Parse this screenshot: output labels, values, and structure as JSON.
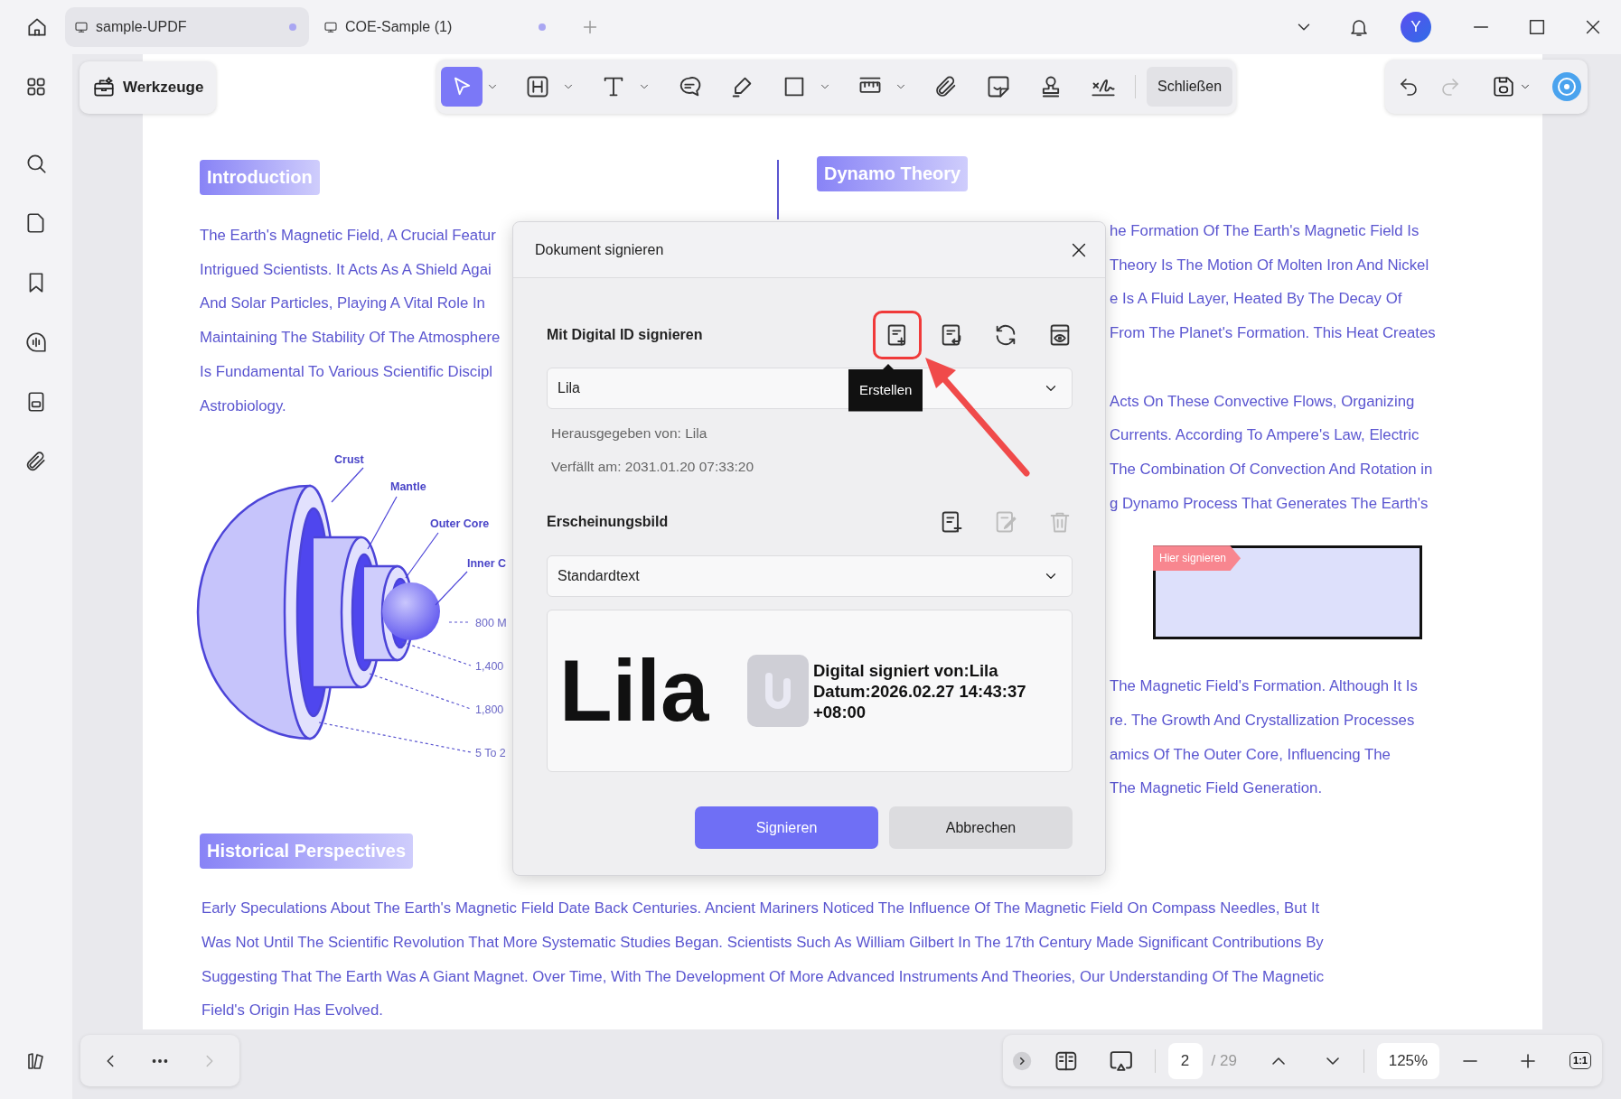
{
  "window": {
    "tabs": [
      {
        "label": "sample-UPDF",
        "selected": true
      },
      {
        "label": "COE-Sample (1)",
        "selected": false
      }
    ],
    "avatar": "Y"
  },
  "tools_button": "Werkzeuge",
  "toolbar": {
    "tools": [
      {
        "kind": "select",
        "selected": true,
        "dropdown": true
      },
      {
        "kind": "heading",
        "selected": false,
        "dropdown": true
      },
      {
        "kind": "text",
        "selected": false,
        "dropdown": true
      },
      {
        "kind": "comment",
        "selected": false,
        "dropdown": false
      },
      {
        "kind": "highlighter",
        "selected": false,
        "dropdown": false
      },
      {
        "kind": "rectangle",
        "selected": false,
        "dropdown": true
      },
      {
        "kind": "measure",
        "selected": false,
        "dropdown": true
      },
      {
        "kind": "attachment",
        "selected": false,
        "dropdown": false
      },
      {
        "kind": "sticker",
        "selected": false,
        "dropdown": false
      },
      {
        "kind": "stamp",
        "selected": false,
        "dropdown": false
      },
      {
        "kind": "signature",
        "selected": false,
        "dropdown": false
      }
    ],
    "close_label": "Schließen"
  },
  "history": [
    {
      "kind": "undo",
      "disabled": false
    },
    {
      "kind": "redo",
      "disabled": true
    }
  ],
  "document": {
    "introduction": {
      "heading": "Introduction",
      "lines": [
        "The Earth's Magnetic Field, A Crucial Featur",
        "Intrigued Scientists. It Acts As A Shield Agai",
        "And Solar Particles, Playing A Vital Role In",
        "Maintaining The Stability Of The Atmosphere",
        "Is Fundamental To Various Scientific Discipl",
        "Astrobiology."
      ]
    },
    "diagram_labels": [
      {
        "text": "Crust",
        "kind": "layer"
      },
      {
        "text": "Mantle",
        "kind": "layer"
      },
      {
        "text": "Outer Core",
        "kind": "layer"
      },
      {
        "text": "Inner C",
        "kind": "layer"
      },
      {
        "text": "800 M",
        "kind": "distance"
      },
      {
        "text": "1,400",
        "kind": "distance"
      },
      {
        "text": "1,800",
        "kind": "distance"
      },
      {
        "text": "5 To 2",
        "kind": "distance"
      }
    ],
    "dynamo": {
      "heading": "Dynamo Theory",
      "blocks": [
        [
          "he Formation Of The Earth's Magnetic Field Is",
          "Theory Is The Motion Of Molten Iron And Nickel",
          "e Is A Fluid Layer, Heated By The Decay Of",
          "From The Planet's Formation. This Heat Creates"
        ],
        [
          "Acts On These Convective Flows, Organizing",
          "Currents. According To Ampere's Law, Electric",
          "The Combination Of Convection And Rotation in",
          "g Dynamo Process That Generates The Earth's"
        ]
      ],
      "signature_field": {
        "label": "Hier signieren"
      },
      "after": [
        "The Magnetic Field's Formation. Although It Is",
        "re. The Growth And Crystallization Processes",
        "amics Of The Outer Core, Influencing The",
        "The Magnetic Field Generation."
      ]
    },
    "historical": {
      "heading": "Historical Perspectives",
      "lines": [
        "Early Speculations About The Earth's Magnetic Field Date Back Centuries. Ancient Mariners Noticed The Influence Of The Magnetic Field On Compass Needles, But It",
        "Was Not Until The Scientific Revolution That More Systematic Studies Began. Scientists Such As William Gilbert In The 17th Century Made Significant Contributions By",
        "Suggesting That The Earth Was A Giant Magnet. Over Time, With The Development Of More Advanced Instruments And Theories, Our Understanding Of The Magnetic",
        "Field's Origin Has Evolved."
      ]
    }
  },
  "dialog": {
    "title": "Dokument signieren",
    "digital_id": {
      "heading": "Mit Digital ID signieren",
      "actions": [
        {
          "kind": "create",
          "highlighted": true
        },
        {
          "kind": "import",
          "highlighted": false
        },
        {
          "kind": "refresh",
          "highlighted": false
        },
        {
          "kind": "view",
          "highlighted": false
        }
      ],
      "tooltip": "Erstellen",
      "value": "Lila",
      "issued_by": "Herausgegeben von: Lila",
      "expires": "Verfällt am: 2031.01.20 07:33:20"
    },
    "appearance": {
      "heading": "Erscheinungsbild",
      "actions": [
        {
          "kind": "add",
          "disabled": false
        },
        {
          "kind": "edit",
          "disabled": true
        },
        {
          "kind": "delete",
          "disabled": true
        }
      ],
      "value": "Standardtext"
    },
    "preview": {
      "name": "Lila",
      "lines": [
        "Digital signiert von:Lila",
        "Datum:2026.02.27 14:43:37",
        "+08:00"
      ]
    },
    "buttons": [
      {
        "label": "Signieren",
        "kind": "primary"
      },
      {
        "label": "Abbrechen",
        "kind": "secondary"
      }
    ]
  },
  "navigation": {
    "next_disabled": true
  },
  "page_bar": {
    "page": "2",
    "total": "/ 29",
    "zoom": "125%",
    "actual_size": "1:1"
  }
}
